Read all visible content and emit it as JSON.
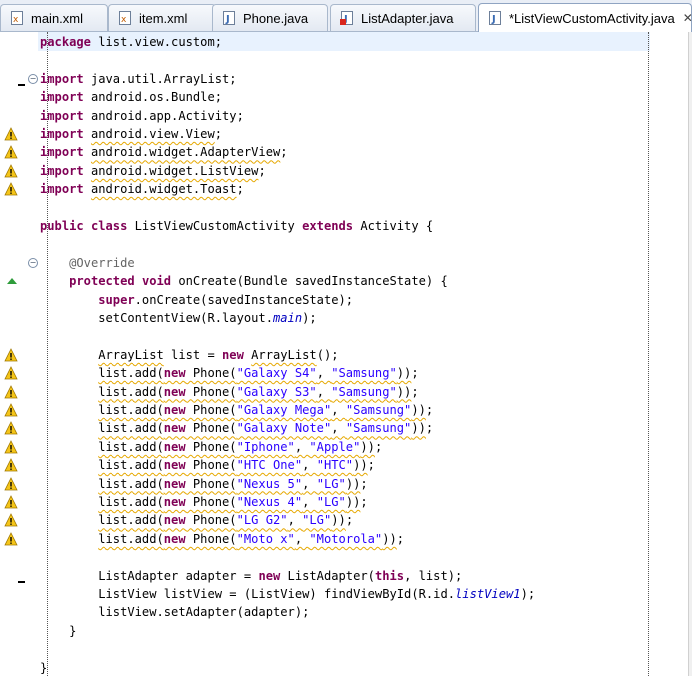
{
  "tabs": [
    {
      "label": "main.xml",
      "icon": "xml-file-icon",
      "active": false
    },
    {
      "label": "item.xml",
      "icon": "xml-file-icon",
      "active": false
    },
    {
      "label": "Phone.java",
      "icon": "java-file-icon",
      "active": false
    },
    {
      "label": "ListAdapter.java",
      "icon": "java-error-file-icon",
      "active": false
    },
    {
      "label": "*ListViewCustomActivity.java",
      "icon": "java-file-icon",
      "active": true
    }
  ],
  "close_glyph": "✕",
  "colors": {
    "keyword": "#7f0055",
    "string": "#2a00ff",
    "annotation": "#646464",
    "field_italic": "#0000c0",
    "warning_underline": "#e6a800",
    "current_line": "#e8f2fe"
  },
  "code": [
    [
      {
        "t": "package",
        "c": "kw"
      },
      {
        "t": " list.view.custom;"
      }
    ],
    [],
    [
      {
        "t": "import",
        "c": "kw"
      },
      {
        "t": " java.util.ArrayList;"
      }
    ],
    [
      {
        "t": "import",
        "c": "kw"
      },
      {
        "t": " android.os.Bundle;"
      }
    ],
    [
      {
        "t": "import",
        "c": "kw"
      },
      {
        "t": " android.app.Activity;"
      }
    ],
    [
      {
        "t": "import",
        "c": "kw"
      },
      {
        "t": " "
      },
      {
        "t": "android.view.View",
        "c": "warn"
      },
      {
        "t": ";"
      }
    ],
    [
      {
        "t": "import",
        "c": "kw"
      },
      {
        "t": " "
      },
      {
        "t": "android.widget.AdapterView",
        "c": "warn"
      },
      {
        "t": ";"
      }
    ],
    [
      {
        "t": "import",
        "c": "kw"
      },
      {
        "t": " "
      },
      {
        "t": "android.widget.ListView",
        "c": "warn"
      },
      {
        "t": ";"
      }
    ],
    [
      {
        "t": "import",
        "c": "kw"
      },
      {
        "t": " "
      },
      {
        "t": "android.widget.Toast",
        "c": "warn"
      },
      {
        "t": ";"
      }
    ],
    [],
    [
      {
        "t": "public",
        "c": "kw"
      },
      {
        "t": " "
      },
      {
        "t": "class",
        "c": "kw"
      },
      {
        "t": " ListViewCustomActivity "
      },
      {
        "t": "extends",
        "c": "kw"
      },
      {
        "t": " Activity {"
      }
    ],
    [],
    [
      {
        "t": "    "
      },
      {
        "t": "@Override",
        "c": "ann"
      }
    ],
    [
      {
        "t": "    "
      },
      {
        "t": "protected",
        "c": "kw"
      },
      {
        "t": " "
      },
      {
        "t": "void",
        "c": "kw"
      },
      {
        "t": " onCreate(Bundle savedInstanceState) {"
      }
    ],
    [
      {
        "t": "        "
      },
      {
        "t": "super",
        "c": "kw"
      },
      {
        "t": ".onCreate(savedInstanceState);"
      }
    ],
    [
      {
        "t": "        setContentView(R.layout."
      },
      {
        "t": "main",
        "c": "ital"
      },
      {
        "t": ");"
      }
    ],
    [],
    [
      {
        "t": "        "
      },
      {
        "t": "ArrayList",
        "c": "warn"
      },
      {
        "t": " list = "
      },
      {
        "t": "new",
        "c": "kw"
      },
      {
        "t": " "
      },
      {
        "t": "ArrayList",
        "c": "warn"
      },
      {
        "t": "();"
      }
    ],
    [
      {
        "t": "        "
      },
      {
        "t": "list.add(",
        "c": "warn"
      },
      {
        "t": "new",
        "c": "kw warn"
      },
      {
        "t": " Phone(",
        "c": "warn"
      },
      {
        "t": "\"Galaxy S4\"",
        "c": "str warn"
      },
      {
        "t": ", ",
        "c": "warn"
      },
      {
        "t": "\"Samsung\"",
        "c": "str warn"
      },
      {
        "t": "))",
        "c": "warn"
      },
      {
        "t": ";"
      }
    ],
    [
      {
        "t": "        "
      },
      {
        "t": "list.add(",
        "c": "warn"
      },
      {
        "t": "new",
        "c": "kw warn"
      },
      {
        "t": " Phone(",
        "c": "warn"
      },
      {
        "t": "\"Galaxy S3\"",
        "c": "str warn"
      },
      {
        "t": ", ",
        "c": "warn"
      },
      {
        "t": "\"Samsung\"",
        "c": "str warn"
      },
      {
        "t": "))",
        "c": "warn"
      },
      {
        "t": ";"
      }
    ],
    [
      {
        "t": "        "
      },
      {
        "t": "list.add(",
        "c": "warn"
      },
      {
        "t": "new",
        "c": "kw warn"
      },
      {
        "t": " Phone(",
        "c": "warn"
      },
      {
        "t": "\"Galaxy Mega\"",
        "c": "str warn"
      },
      {
        "t": ", ",
        "c": "warn"
      },
      {
        "t": "\"Samsung\"",
        "c": "str warn"
      },
      {
        "t": "))",
        "c": "warn"
      },
      {
        "t": ";"
      }
    ],
    [
      {
        "t": "        "
      },
      {
        "t": "list.add(",
        "c": "warn"
      },
      {
        "t": "new",
        "c": "kw warn"
      },
      {
        "t": " Phone(",
        "c": "warn"
      },
      {
        "t": "\"Galaxy Note\"",
        "c": "str warn"
      },
      {
        "t": ", ",
        "c": "warn"
      },
      {
        "t": "\"Samsung\"",
        "c": "str warn"
      },
      {
        "t": "))",
        "c": "warn"
      },
      {
        "t": ";"
      }
    ],
    [
      {
        "t": "        "
      },
      {
        "t": "list.add(",
        "c": "warn"
      },
      {
        "t": "new",
        "c": "kw warn"
      },
      {
        "t": " Phone(",
        "c": "warn"
      },
      {
        "t": "\"Iphone\"",
        "c": "str warn"
      },
      {
        "t": ", ",
        "c": "warn"
      },
      {
        "t": "\"Apple\"",
        "c": "str warn"
      },
      {
        "t": "))",
        "c": "warn"
      },
      {
        "t": ";"
      }
    ],
    [
      {
        "t": "        "
      },
      {
        "t": "list.add(",
        "c": "warn"
      },
      {
        "t": "new",
        "c": "kw warn"
      },
      {
        "t": " Phone(",
        "c": "warn"
      },
      {
        "t": "\"HTC One\"",
        "c": "str warn"
      },
      {
        "t": ", ",
        "c": "warn"
      },
      {
        "t": "\"HTC\"",
        "c": "str warn"
      },
      {
        "t": "))",
        "c": "warn"
      },
      {
        "t": ";"
      }
    ],
    [
      {
        "t": "        "
      },
      {
        "t": "list.add(",
        "c": "warn"
      },
      {
        "t": "new",
        "c": "kw warn"
      },
      {
        "t": " Phone(",
        "c": "warn"
      },
      {
        "t": "\"Nexus 5\"",
        "c": "str warn"
      },
      {
        "t": ", ",
        "c": "warn"
      },
      {
        "t": "\"LG\"",
        "c": "str warn"
      },
      {
        "t": "))",
        "c": "warn"
      },
      {
        "t": ";"
      }
    ],
    [
      {
        "t": "        "
      },
      {
        "t": "list.add(",
        "c": "warn"
      },
      {
        "t": "new",
        "c": "kw warn"
      },
      {
        "t": " Phone(",
        "c": "warn"
      },
      {
        "t": "\"Nexus 4\"",
        "c": "str warn"
      },
      {
        "t": ", ",
        "c": "warn"
      },
      {
        "t": "\"LG\"",
        "c": "str warn"
      },
      {
        "t": "))",
        "c": "warn"
      },
      {
        "t": ";"
      }
    ],
    [
      {
        "t": "        "
      },
      {
        "t": "list.add(",
        "c": "warn"
      },
      {
        "t": "new",
        "c": "kw warn"
      },
      {
        "t": " Phone(",
        "c": "warn"
      },
      {
        "t": "\"LG G2\"",
        "c": "str warn"
      },
      {
        "t": ", ",
        "c": "warn"
      },
      {
        "t": "\"LG\"",
        "c": "str warn"
      },
      {
        "t": "))",
        "c": "warn"
      },
      {
        "t": ";"
      }
    ],
    [
      {
        "t": "        "
      },
      {
        "t": "list.add(",
        "c": "warn"
      },
      {
        "t": "new",
        "c": "kw warn"
      },
      {
        "t": " Phone(",
        "c": "warn"
      },
      {
        "t": "\"Moto x\"",
        "c": "str warn"
      },
      {
        "t": ", ",
        "c": "warn"
      },
      {
        "t": "\"Motorola\"",
        "c": "str warn"
      },
      {
        "t": "))",
        "c": "warn"
      },
      {
        "t": ";"
      }
    ],
    [],
    [
      {
        "t": "        ListAdapter adapter = "
      },
      {
        "t": "new",
        "c": "kw"
      },
      {
        "t": " ListAdapter("
      },
      {
        "t": "this",
        "c": "kw"
      },
      {
        "t": ", list);"
      }
    ],
    [
      {
        "t": "        ListView listView = (ListView) findViewById(R.id."
      },
      {
        "t": "listView1",
        "c": "ital"
      },
      {
        "t": ");"
      }
    ],
    [
      {
        "t": "        listView.setAdapter(adapter);"
      }
    ],
    [
      {
        "t": "    }"
      }
    ],
    [],
    [
      {
        "t": "}"
      }
    ]
  ],
  "gutter": {
    "warning_lines": [
      5,
      6,
      7,
      8,
      17,
      18,
      19,
      20,
      21,
      22,
      23,
      24,
      25,
      26,
      27
    ],
    "fold_lines": [
      2,
      12
    ],
    "change_lines": [
      2,
      29
    ],
    "override_lines": [
      13
    ]
  }
}
